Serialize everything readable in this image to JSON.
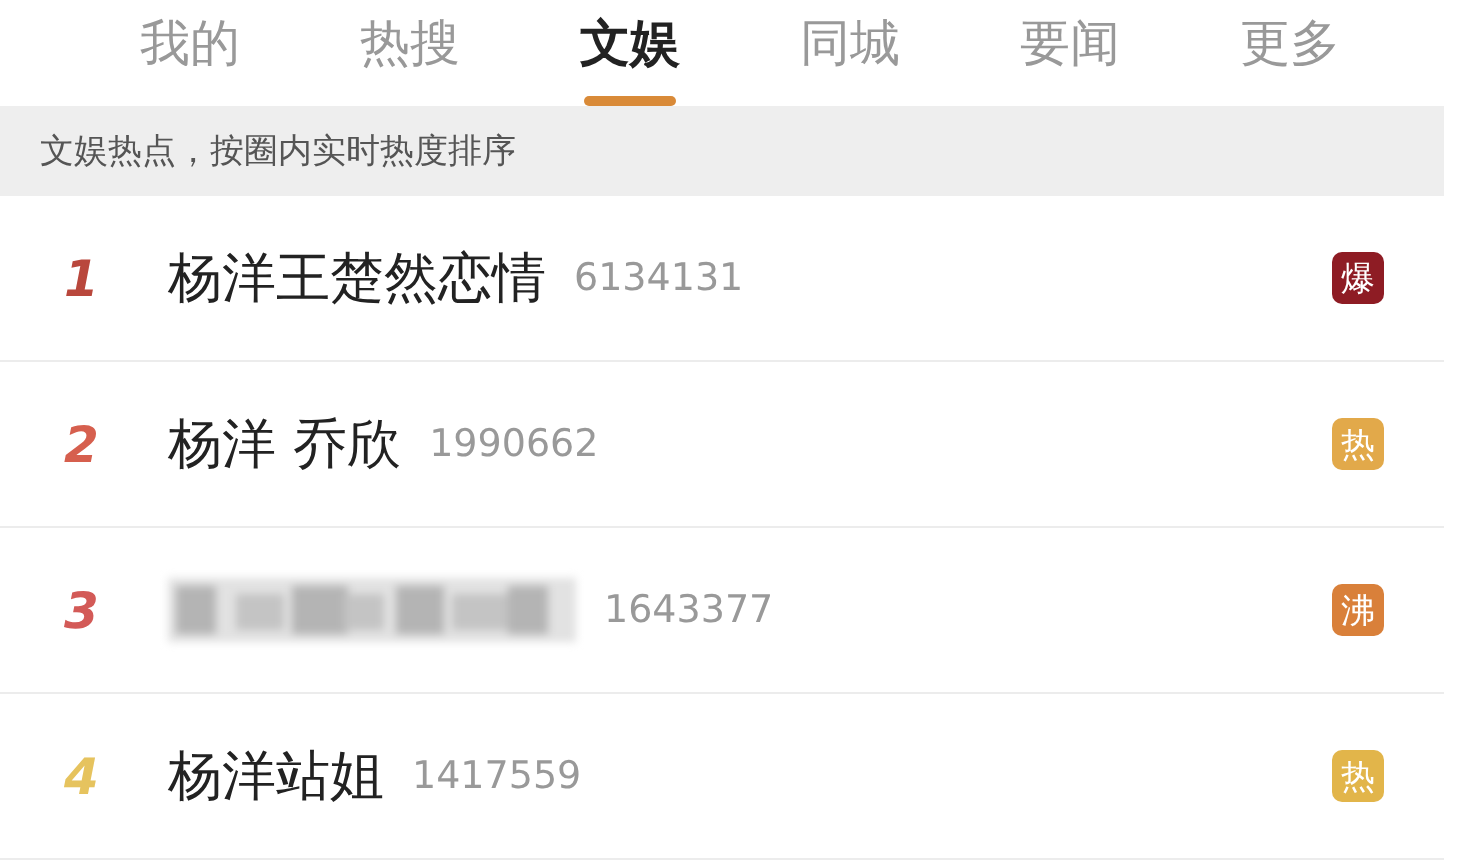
{
  "tabs": [
    {
      "label": "我的",
      "selected": false
    },
    {
      "label": "热搜",
      "selected": false
    },
    {
      "label": "文娱",
      "selected": true
    },
    {
      "label": "同城",
      "selected": false
    },
    {
      "label": "要闻",
      "selected": false
    },
    {
      "label": "更多",
      "selected": false
    }
  ],
  "notice": "文娱热点，按圈内实时热度排序",
  "rows": [
    {
      "rank": "1",
      "color": "#b9473c",
      "kind": "text",
      "title": "杨洋王楚然恋情",
      "count": "6134131",
      "badge": {
        "text": "爆",
        "color": "#8e1c24"
      }
    },
    {
      "rank": "2",
      "color": "#d65f4e",
      "kind": "text",
      "title": "杨洋 乔欣",
      "count": "1990662",
      "badge": {
        "text": "热",
        "color": "#e2a94a"
      }
    },
    {
      "rank": "3",
      "color": "#d35a57",
      "kind": "blurred",
      "count": "1643377",
      "badge": {
        "text": "沸",
        "color": "#d9803a"
      }
    },
    {
      "rank": "4",
      "color": "#e6c35e",
      "kind": "text",
      "title": "杨洋站姐",
      "count": "1417559",
      "badge": {
        "text": "热",
        "color": "#e2b54a"
      }
    }
  ]
}
